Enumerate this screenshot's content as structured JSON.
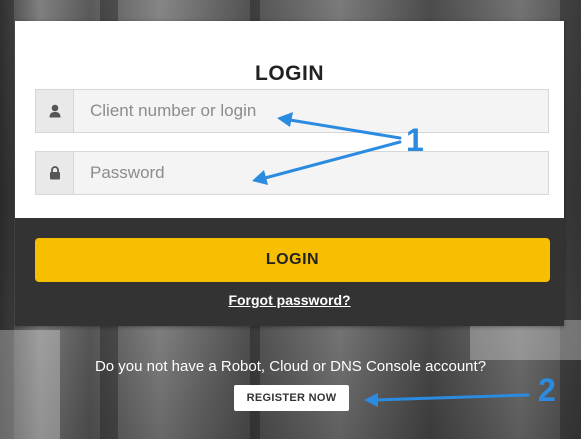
{
  "login_card": {
    "title": "LOGIN",
    "username": {
      "placeholder": "Client number or login",
      "value": "",
      "icon": "user-icon"
    },
    "password": {
      "placeholder": "Password",
      "value": "",
      "icon": "lock-icon"
    },
    "login_button": "LOGIN",
    "forgot_link": "Forgot password?"
  },
  "register": {
    "prompt": "Do you not have a Robot, Cloud or DNS Console account?",
    "button": "REGISTER NOW"
  },
  "annotations": {
    "label_1": "1",
    "label_2": "2",
    "color": "#2b8be0"
  },
  "colors": {
    "accent": "#f7bf00",
    "dark_panel": "#333333"
  }
}
